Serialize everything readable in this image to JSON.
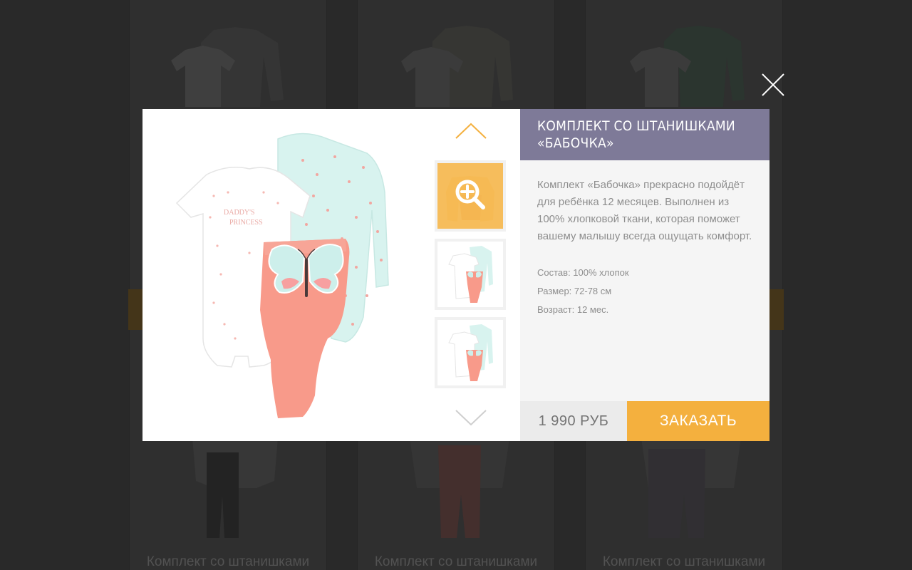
{
  "product": {
    "title": "КОМПЛЕКТ СО ШТАНИШКАМИ «БАБОЧКА»",
    "description": "Комплект «Бабочка» прекрасно подойдёт для ребёнка 12 месяцев. Выполнен из 100% хлопковой ткани, которая поможет вашему малышу всегда ощущать комфорт.",
    "specs": [
      "Состав: 100% хлопок",
      "Размер: 72-78 см",
      "Возраст: 12 мес."
    ],
    "price": "1 990 РУБ",
    "order_label": "ЗАКАЗАТЬ",
    "onesie_print": [
      "DADDY'S",
      "PRINCESS"
    ]
  },
  "icons": {
    "close": "close-icon",
    "up": "chevron-up-icon",
    "down": "chevron-down-icon",
    "zoom": "zoom-in-icon"
  },
  "colors": {
    "header_bg": "#7e7a98",
    "accent": "#f4b03e",
    "price_bg": "#ebebeb",
    "panel_bg": "#f5f5f5"
  },
  "background_catalog": {
    "captions": [
      "Комплект со штанишками",
      "Комплект со штанишками",
      "Комплект со штанишками"
    ]
  }
}
